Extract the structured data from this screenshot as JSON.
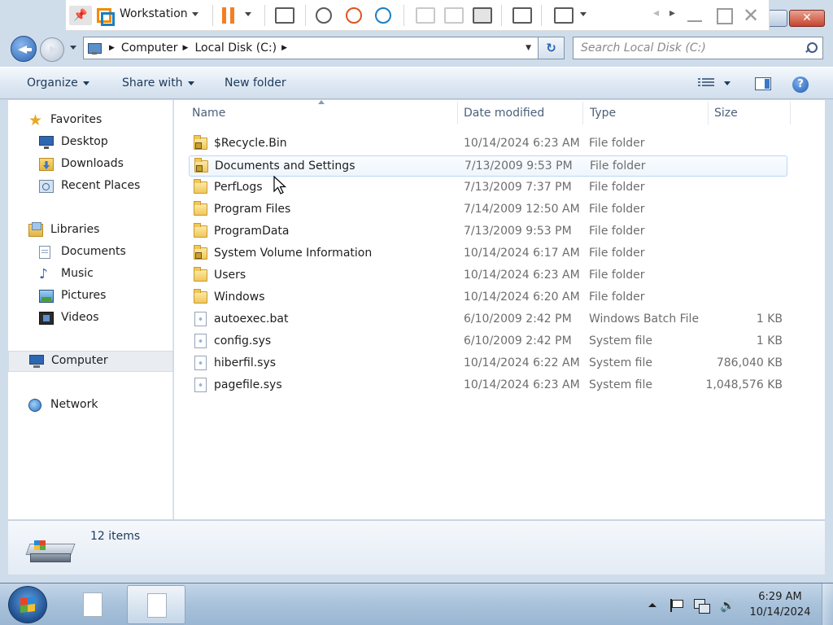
{
  "vm_toolbar": {
    "title": "Workstation"
  },
  "address": {
    "crumbs": [
      "Computer",
      "Local Disk (C:)"
    ]
  },
  "search": {
    "placeholder": "Search Local Disk (C:)"
  },
  "commands": {
    "organize": "Organize",
    "share_with": "Share with",
    "new_folder": "New folder"
  },
  "nav": {
    "favorites": "Favorites",
    "desktop": "Desktop",
    "downloads": "Downloads",
    "recent_places": "Recent Places",
    "libraries": "Libraries",
    "documents": "Documents",
    "music": "Music",
    "pictures": "Pictures",
    "videos": "Videos",
    "computer": "Computer",
    "network": "Network"
  },
  "columns": {
    "name": "Name",
    "date_modified": "Date modified",
    "type": "Type",
    "size": "Size"
  },
  "files": [
    {
      "name": "$Recycle.Bin",
      "date": "10/14/2024 6:23 AM",
      "type": "File folder",
      "size": "",
      "icon": "locked-folder-icon"
    },
    {
      "name": "Documents and Settings",
      "date": "7/13/2009 9:53 PM",
      "type": "File folder",
      "size": "",
      "icon": "locked-folder-icon"
    },
    {
      "name": "PerfLogs",
      "date": "7/13/2009 7:37 PM",
      "type": "File folder",
      "size": "",
      "icon": "folder-icon"
    },
    {
      "name": "Program Files",
      "date": "7/14/2009 12:50 AM",
      "type": "File folder",
      "size": "",
      "icon": "folder-icon"
    },
    {
      "name": "ProgramData",
      "date": "7/13/2009 9:53 PM",
      "type": "File folder",
      "size": "",
      "icon": "folder-icon"
    },
    {
      "name": "System Volume Information",
      "date": "10/14/2024 6:17 AM",
      "type": "File folder",
      "size": "",
      "icon": "locked-folder-icon"
    },
    {
      "name": "Users",
      "date": "10/14/2024 6:23 AM",
      "type": "File folder",
      "size": "",
      "icon": "folder-icon"
    },
    {
      "name": "Windows",
      "date": "10/14/2024 6:20 AM",
      "type": "File folder",
      "size": "",
      "icon": "folder-icon"
    },
    {
      "name": "autoexec.bat",
      "date": "6/10/2009 2:42 PM",
      "type": "Windows Batch File",
      "size": "1 KB",
      "icon": "batch-file-icon"
    },
    {
      "name": "config.sys",
      "date": "6/10/2009 2:42 PM",
      "type": "System file",
      "size": "1 KB",
      "icon": "system-file-icon"
    },
    {
      "name": "hiberfil.sys",
      "date": "10/14/2024 6:22 AM",
      "type": "System file",
      "size": "786,040 KB",
      "icon": "system-file-icon"
    },
    {
      "name": "pagefile.sys",
      "date": "10/14/2024 6:23 AM",
      "type": "System file",
      "size": "1,048,576 KB",
      "icon": "system-file-icon"
    }
  ],
  "hovered_row": 1,
  "details": {
    "item_count": "12 items"
  },
  "clock": {
    "time": "6:29 AM",
    "date": "10/14/2024"
  },
  "colors": {
    "accent_orange": "#f57e20",
    "selection_border": "#b8d6fb",
    "folder_yellow": "#f0c75b"
  }
}
